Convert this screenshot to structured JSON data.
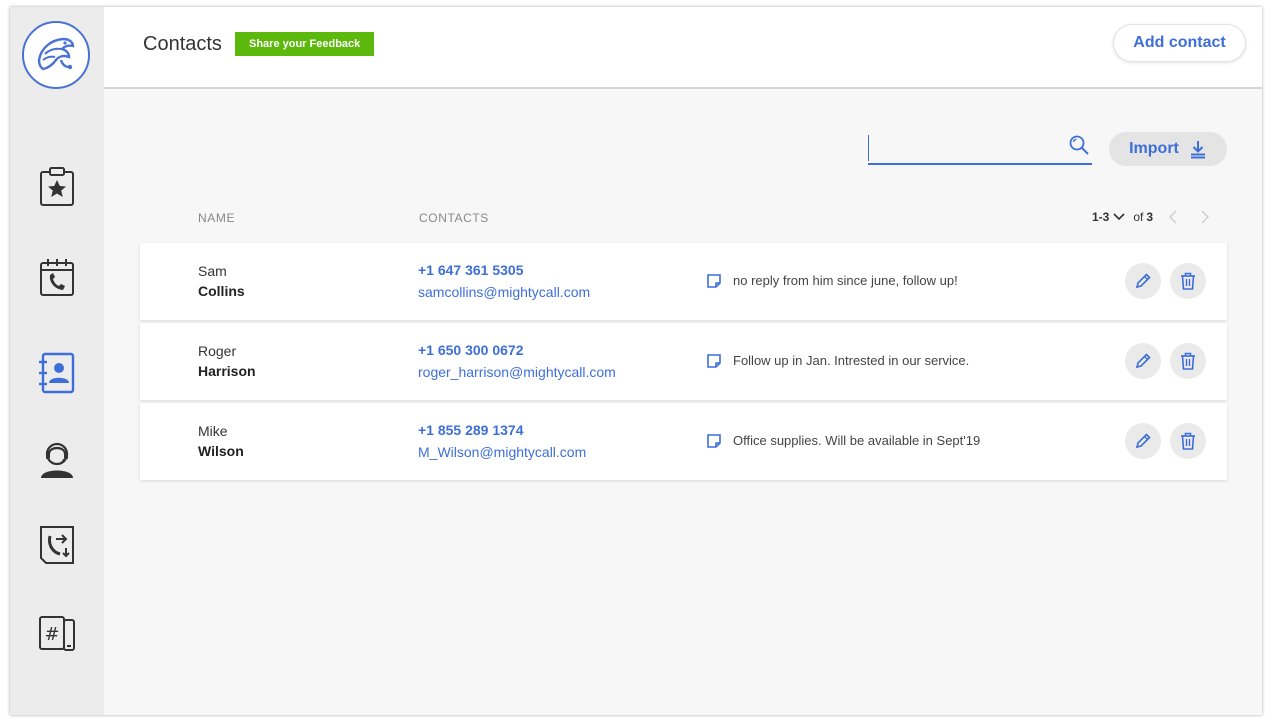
{
  "header": {
    "title": "Contacts",
    "feedback_label": "Share your Feedback",
    "add_contact_label": "Add contact"
  },
  "toolbar": {
    "search_value": "",
    "import_label": "Import"
  },
  "table": {
    "columns": [
      "NAME",
      "CONTACTS"
    ],
    "pagination": {
      "range": "1-3",
      "of_label": "of",
      "total": "3"
    },
    "rows": [
      {
        "first": "Sam",
        "last": "Collins",
        "phone": "+1 647 361 5305",
        "email": "samcollins@mightycall.com",
        "note": "no reply from him since june, follow up!"
      },
      {
        "first": "Roger",
        "last": "Harrison",
        "phone": "+1 650 300 0672",
        "email": "roger_harrison@mightycall.com",
        "note": "Follow up in Jan. Intrested in our service."
      },
      {
        "first": "Mike",
        "last": "Wilson",
        "phone": "+1 855 289 1374",
        "email": "M_Wilson@mightycall.com",
        "note": "Office supplies. Will be available in Sept'19"
      }
    ]
  },
  "sidebar": {
    "items": [
      {
        "icon": "clipboard-star-icon"
      },
      {
        "icon": "calendar-phone-icon"
      },
      {
        "icon": "address-book-icon"
      },
      {
        "icon": "agent-headset-icon"
      },
      {
        "icon": "call-transfer-icon"
      },
      {
        "icon": "hashtag-phone-icon"
      }
    ]
  },
  "colors": {
    "accent": "#3e6fd8",
    "feedback_green": "#5cb80b",
    "sidebar_bg": "#ececec",
    "content_bg": "#f7f7f7"
  }
}
